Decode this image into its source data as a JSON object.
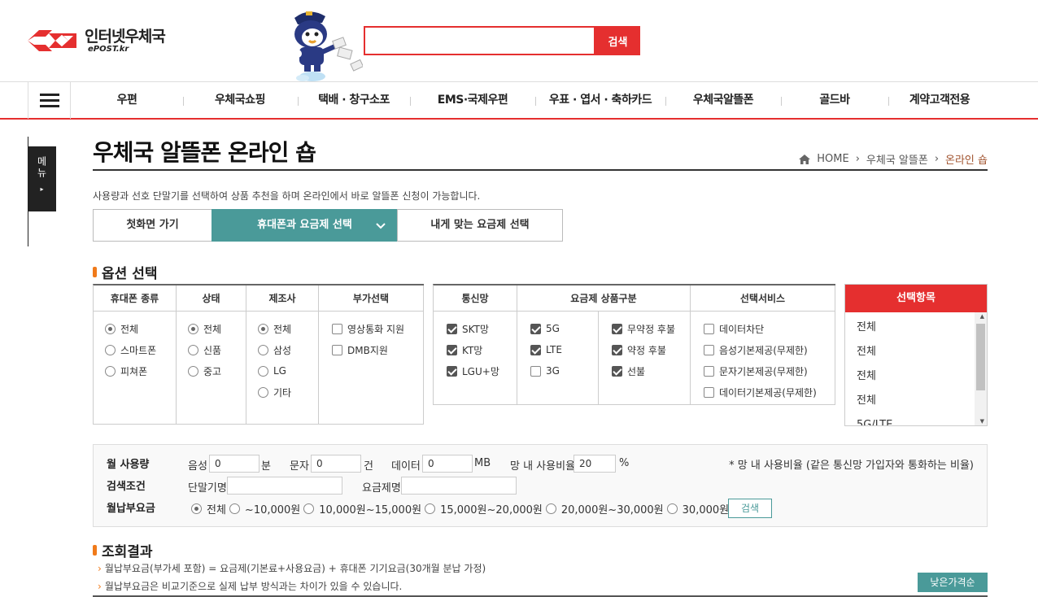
{
  "header": {
    "logo_text": "인터넷우체국",
    "logo_sub": "ePOST.kr",
    "search_placeholder": "",
    "search_button": "검색"
  },
  "gnb": {
    "items": [
      "우편",
      "우체국쇼핑",
      "택배 · 창구소포",
      "EMS·국제우편",
      "우표 · 엽서 · 축하카드",
      "우체국알뜰폰",
      "골드바",
      "계약고객전용"
    ]
  },
  "side_tab": {
    "label": "메뉴",
    "arrow": "▸"
  },
  "page": {
    "title": "우체국 알뜰폰 온라인 숍",
    "breadcrumb": [
      "HOME",
      "우체국 알뜰폰",
      "온라인 숍"
    ],
    "breadcrumb_sep": "›",
    "description": "사용량과 선호 단말기를 선택하여 상품 추천을 하며 온라인에서 바로 알뜰폰 신청이 가능합니다."
  },
  "tabs": [
    "첫화면 가기",
    "휴대폰과 요금제 선택",
    "내게 맞는 요금제 선택"
  ],
  "options": {
    "section_title": "옵션 선택",
    "phone_type": {
      "header": "휴대폰 종류",
      "items": [
        "전체",
        "스마트폰",
        "피쳐폰"
      ],
      "selected": 0
    },
    "status": {
      "header": "상태",
      "items": [
        "전체",
        "신품",
        "중고"
      ],
      "selected": 0
    },
    "maker": {
      "header": "제조사",
      "items": [
        "전체",
        "삼성",
        "LG",
        "기타"
      ],
      "selected": 0
    },
    "extra": {
      "header": "부가선택",
      "items": [
        "영상통화 지원",
        "DMB지원"
      ],
      "checked": [
        false,
        false
      ]
    },
    "network": {
      "header": "통신망",
      "items": [
        "SKT망",
        "KT망",
        "LGU+망"
      ],
      "checked": [
        true,
        true,
        true
      ]
    },
    "plan_type_header": "요금제 상품구분",
    "plan_gen": {
      "items": [
        "5G",
        "LTE",
        "3G"
      ],
      "checked": [
        true,
        true,
        false
      ]
    },
    "plan_pay": {
      "items": [
        "무약정 후불",
        "약정 후불",
        "선불"
      ],
      "checked": [
        true,
        true,
        true
      ]
    },
    "service": {
      "header": "선택서비스",
      "items": [
        "데이터차단",
        "음성기본제공(무제한)",
        "문자기본제공(무제한)",
        "데이터기본제공(무제한)"
      ],
      "checked": [
        false,
        false,
        false,
        false
      ]
    }
  },
  "selected_panel": {
    "header": "선택항목",
    "items": [
      "전체",
      "전체",
      "전체",
      "전체",
      "5G/LTE"
    ]
  },
  "conditions": {
    "usage_label": "월 사용량",
    "voice_label": "음성",
    "voice_value": "0",
    "voice_unit": "분",
    "sms_label": "문자",
    "sms_value": "0",
    "sms_unit": "건",
    "data_label": "데이터",
    "data_value": "0",
    "data_unit": "MB",
    "ratio_label": "망 내 사용비율",
    "ratio_value": "20",
    "ratio_unit": "%",
    "note": "* 망 내 사용비율 (같은 통신망 가입자와 통화하는 비율)",
    "search_label": "검색조건",
    "device_label": "단말기명",
    "device_value": "",
    "plan_label": "요금제명",
    "plan_value": "",
    "fee_label": "월납부요금",
    "fee_options": [
      "전체",
      "~10,000원",
      "10,000원~15,000원",
      "15,000원~20,000원",
      "20,000원~30,000원",
      "30,000원~"
    ],
    "fee_selected": 0,
    "search_button": "검색"
  },
  "results": {
    "section_title": "조회결과",
    "notes": [
      "월납부요금(부가세 포함) = 요금제(기본료+사용요금) + 휴대폰 기기요금(30개월 분납 가정)",
      "월납부요금은 비교기준으로 실제 납부 방식과는 차이가 있을 수 있습니다."
    ],
    "sort_button": "낮은가격순"
  },
  "colors": {
    "brand_red": "#e52f2f",
    "teal": "#4a9a99",
    "orange": "#f07a1a"
  }
}
